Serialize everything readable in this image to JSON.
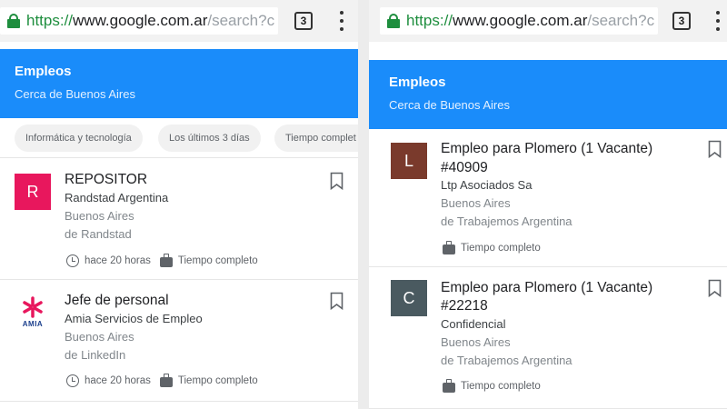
{
  "browser": {
    "url_scheme": "https://",
    "url_host": "www.google.com.ar",
    "url_path": "/search?c",
    "tab_count": "3"
  },
  "left": {
    "header": {
      "title": "Empleos",
      "subtitle": "Cerca de Buenos Aires"
    },
    "chips": [
      "Informática y tecnología",
      "Los últimos 3 días",
      "Tiempo complet"
    ],
    "jobs": [
      {
        "logo_letter": "R",
        "logo_color": "#e8175d",
        "title": "REPOSITOR",
        "company": "Randstad Argentina",
        "location": "Buenos Aires",
        "via": "de Randstad",
        "posted": "hace 20 horas",
        "type": "Tiempo completo"
      },
      {
        "logo_text": "AMIA",
        "logo_colors": [
          "#e8175d",
          "#1a3e8c"
        ],
        "title": "Jefe de personal",
        "company": "Amia Servicios de Empleo",
        "location": "Buenos Aires",
        "via": "de LinkedIn",
        "posted": "hace 20 horas",
        "type": "Tiempo completo"
      }
    ]
  },
  "right": {
    "header": {
      "title": "Empleos",
      "subtitle": "Cerca de Buenos Aires"
    },
    "jobs": [
      {
        "logo_letter": "L",
        "logo_color": "#7a3a2c",
        "title_1": "Empleo para Plomero (1 Vacante)",
        "title_2": "#40909",
        "company": "Ltp Asociados Sa",
        "location": "Buenos Aires",
        "via": "de Trabajemos Argentina",
        "type": "Tiempo completo"
      },
      {
        "logo_letter": "C",
        "logo_color": "#4a5a60",
        "title_1": "Empleo para Plomero (1 Vacante)",
        "title_2": "#22218",
        "company": "Confidencial",
        "location": "Buenos Aires",
        "via": "de Trabajemos Argentina",
        "type": "Tiempo completo"
      }
    ]
  },
  "colors": {
    "header_blue": "#1a8cfa",
    "secure_green": "#1e8e3e"
  }
}
